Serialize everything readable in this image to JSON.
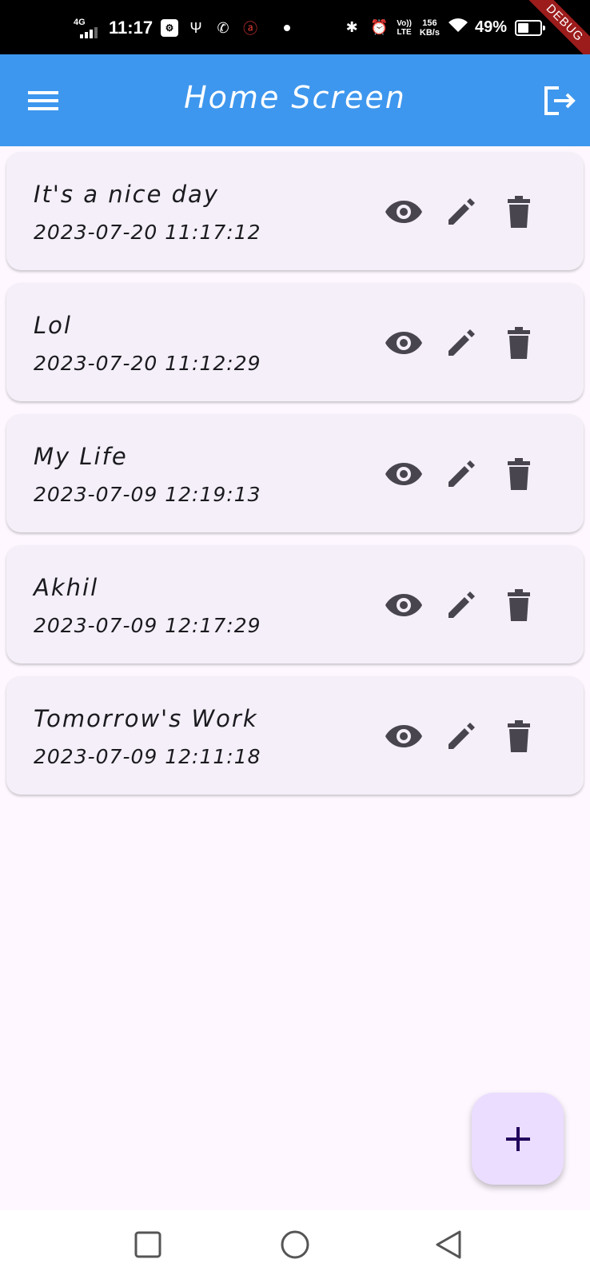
{
  "status_bar": {
    "network": "4G",
    "time": "11:17",
    "volte_top": "Vo))",
    "volte_bottom": "LTE",
    "speed_value": "156",
    "speed_unit": "KB/s",
    "battery_percent": "49%",
    "battery_level": 0.49,
    "debug_label": "DEBUG"
  },
  "app_bar": {
    "title": "Home Screen",
    "color": "#3e97ee"
  },
  "notes": [
    {
      "title": "It's a nice day",
      "date": "2023-07-20 11:17:12"
    },
    {
      "title": "Lol",
      "date": "2023-07-20 11:12:29"
    },
    {
      "title": "My Life",
      "date": "2023-07-09 12:19:13"
    },
    {
      "title": "Akhil",
      "date": "2023-07-09 12:17:29"
    },
    {
      "title": "Tomorrow's Work",
      "date": "2023-07-09 12:11:18"
    }
  ],
  "icons": {
    "menu": "menu-icon",
    "logout": "logout-icon",
    "view": "eye-icon",
    "edit": "pencil-icon",
    "delete": "trash-icon",
    "add": "plus-icon"
  },
  "colors": {
    "card": "#f4eff8",
    "icon": "#49454f",
    "fab": "#eaddff",
    "fab_icon": "#21005d"
  }
}
